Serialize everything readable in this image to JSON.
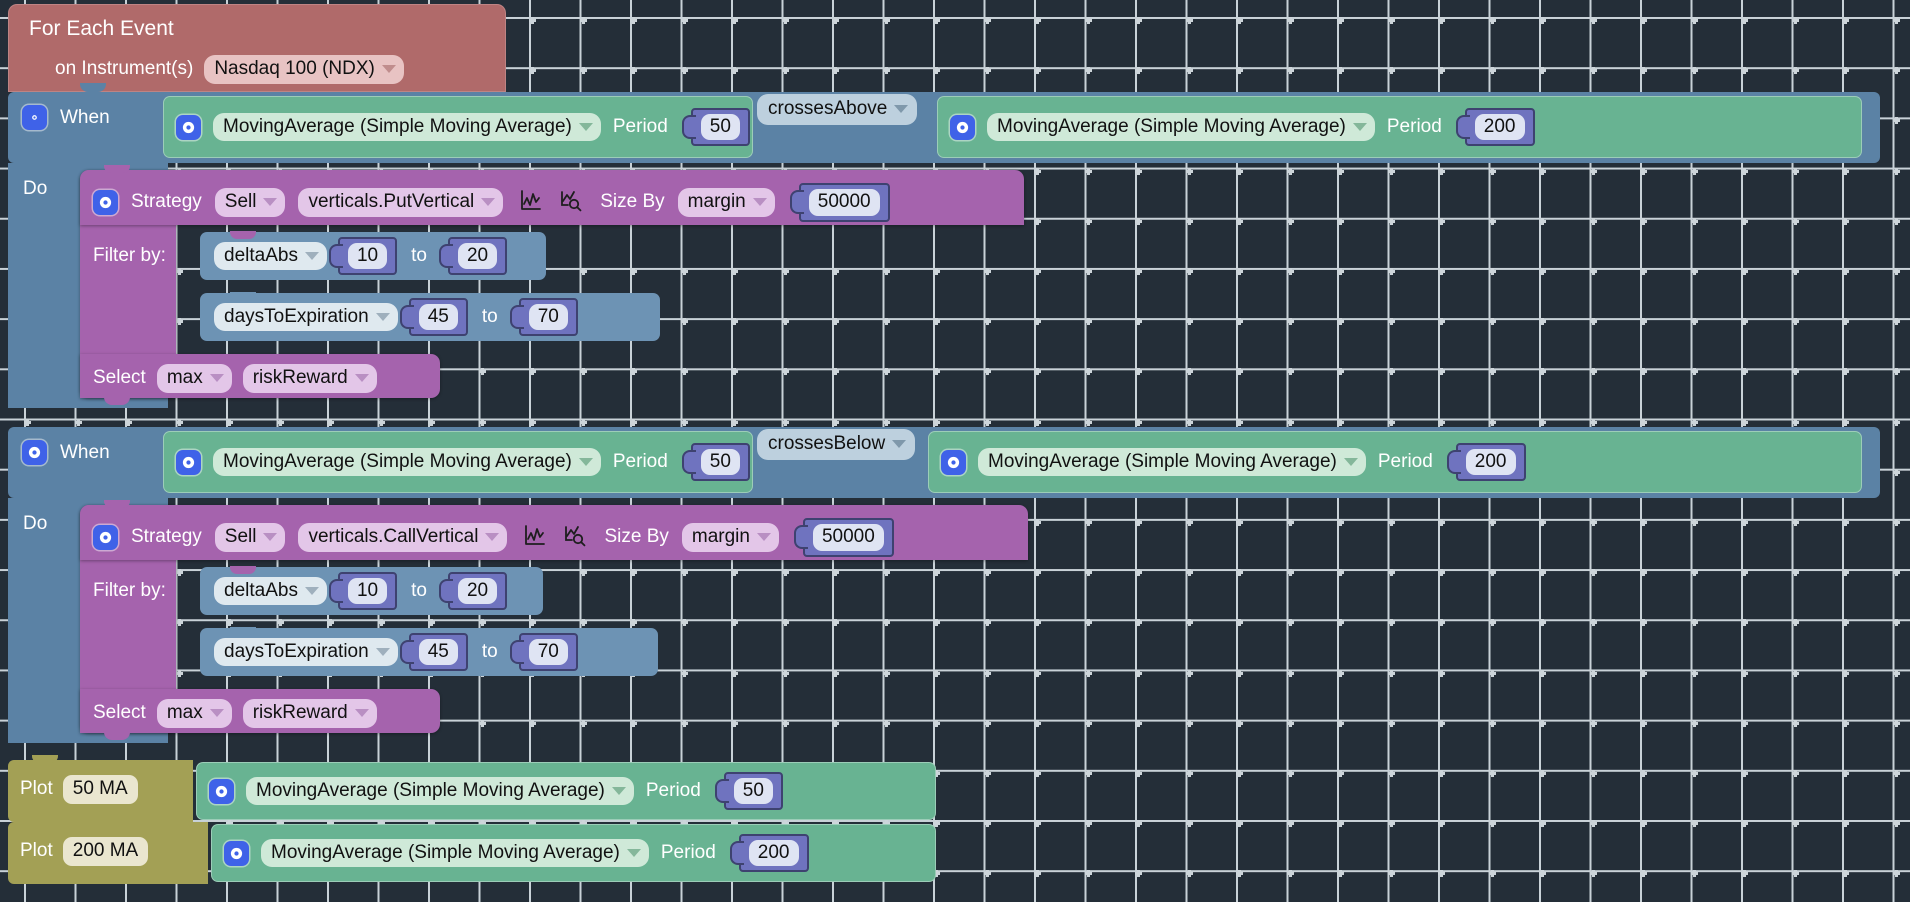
{
  "workspace": {
    "background_color": "#242e38",
    "grid_dot_color": "#cdd5da"
  },
  "for_each_event": {
    "title": "For Each Event",
    "instrument_label": "on Instrument(s)",
    "instrument_value": "Nasdaq 100 (NDX)",
    "color": "#b06a6a"
  },
  "blocks": [
    {
      "id": "rule-1",
      "when_label": "When",
      "gear_icon": "gear-icon",
      "condition": {
        "left": {
          "indicator": "MovingAverage (Simple Moving Average)",
          "period_label": "Period",
          "period_value": "50"
        },
        "operator": "crossesAbove",
        "right": {
          "indicator": "MovingAverage (Simple Moving Average)",
          "period_label": "Period",
          "period_value": "200"
        }
      },
      "do_label": "Do",
      "strategy": {
        "label": "Strategy",
        "action": "Sell",
        "template": "verticals.PutVertical",
        "chart_icon": "line-chart-icon",
        "inspect_icon": "chart-magnifier-icon",
        "size_by_label": "Size By",
        "size_by_value": "margin",
        "size_amount": "50000"
      },
      "filter_label": "Filter by:",
      "filters": [
        {
          "field": "deltaAbs",
          "from": "10",
          "to_label": "to",
          "to": "20"
        },
        {
          "field": "daysToExpiration",
          "from": "45",
          "to_label": "to",
          "to": "70"
        }
      ],
      "select_label": "Select",
      "select_agg": "max",
      "select_field": "riskReward"
    },
    {
      "id": "rule-2",
      "when_label": "When",
      "gear_icon": "gear-icon",
      "condition": {
        "left": {
          "indicator": "MovingAverage (Simple Moving Average)",
          "period_label": "Period",
          "period_value": "50"
        },
        "operator": "crossesBelow",
        "right": {
          "indicator": "MovingAverage (Simple Moving Average)",
          "period_label": "Period",
          "period_value": "200"
        }
      },
      "do_label": "Do",
      "strategy": {
        "label": "Strategy",
        "action": "Sell",
        "template": "verticals.CallVertical",
        "chart_icon": "line-chart-icon",
        "inspect_icon": "chart-magnifier-icon",
        "size_by_label": "Size By",
        "size_by_value": "margin",
        "size_amount": "50000"
      },
      "filter_label": "Filter by:",
      "filters": [
        {
          "field": "deltaAbs",
          "from": "10",
          "to_label": "to",
          "to": "20"
        },
        {
          "field": "daysToExpiration",
          "from": "45",
          "to_label": "to",
          "to": "70"
        }
      ],
      "select_label": "Select",
      "select_agg": "max",
      "select_field": "riskReward"
    }
  ],
  "plots": [
    {
      "plot_label": "Plot",
      "plot_name": "50 MA",
      "indicator": "MovingAverage (Simple Moving Average)",
      "period_label": "Period",
      "period_value": "50"
    },
    {
      "plot_label": "Plot",
      "plot_name": "200 MA",
      "indicator": "MovingAverage (Simple Moving Average)",
      "period_label": "Period",
      "period_value": "200"
    }
  ],
  "colors": {
    "event_block": "#b06a6a",
    "when_block": "#5b82a5",
    "indicator_block": "#68b392",
    "strategy_block": "#a563ad",
    "filter_block": "#6d93b4",
    "plot_block": "#a3a055",
    "number_socket": "#6f73bf"
  }
}
